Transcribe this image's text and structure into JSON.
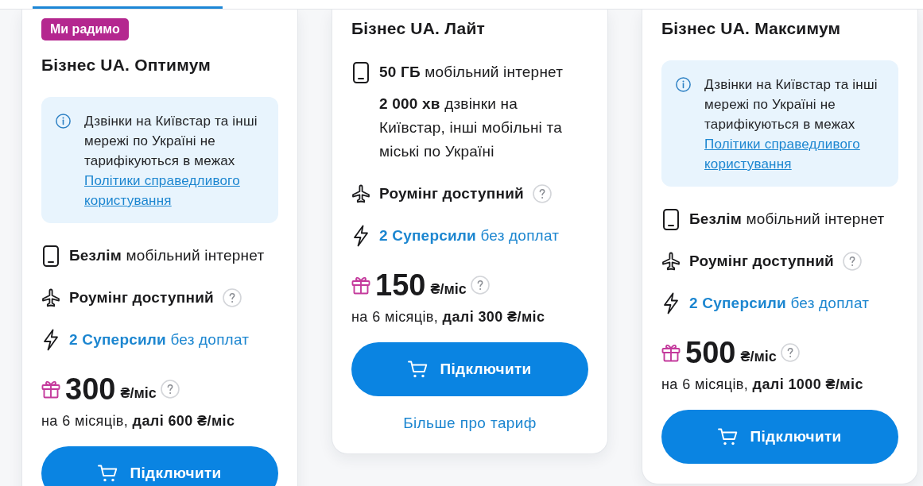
{
  "plans": [
    {
      "badge": "Ми радимо",
      "title": "Бізнес UA. Оптимум",
      "info": {
        "text": "Дзвінки на Київстар та інші мережі по Україні не тарифікуються в межах",
        "link": "Політики справедливого користування"
      },
      "features": [
        {
          "kind": "internet",
          "text": "**Безлім** мобільний інтернет",
          "help": false
        },
        {
          "kind": "roaming",
          "text": "Роумінг доступний",
          "help": true
        },
        {
          "kind": "superpowers",
          "text": "**2 Суперсили** без доплат",
          "help": false
        }
      ],
      "price": {
        "amount": "300",
        "unit": "₴/міс",
        "help": true,
        "note": "на 6 місяців, **далі 600 ₴/міс**"
      },
      "button": "Підключити"
    },
    {
      "title": "Бізнес UA. Лайт",
      "features": [
        {
          "kind": "internet",
          "text": "**50 ГБ** мобільний інтернет",
          "help": false
        },
        {
          "kind": "calls",
          "text": "**2 000 хв** дзвінки на Київстар, інші мобільні та міські по Україні",
          "help": false
        },
        {
          "kind": "roaming",
          "text": "Роумінг доступний",
          "help": true
        },
        {
          "kind": "superpowers",
          "text": "**2 Суперсили** без доплат",
          "help": false
        }
      ],
      "price": {
        "amount": "150",
        "unit": "₴/міс",
        "help": true,
        "note": "на 6 місяців, **далі 300 ₴/міс**"
      },
      "button": "Підключити",
      "more_link": "Більше про тариф"
    },
    {
      "title": "Бізнес UA. Максимум",
      "info": {
        "text": "Дзвінки на Київстар та інші мережі по Україні не тарифікуються в межах",
        "link": "Політики справедливого користування"
      },
      "features": [
        {
          "kind": "internet",
          "text": "**Безлім** мобільний інтернет",
          "help": false
        },
        {
          "kind": "roaming",
          "text": "Роумінг доступний",
          "help": true
        },
        {
          "kind": "superpowers",
          "text": "**2 Суперсили** без доплат",
          "help": false
        }
      ],
      "price": {
        "amount": "500",
        "unit": "₴/міс",
        "help": true,
        "note": "на 6 місяців, **далі 1000 ₴/міс**"
      },
      "button": "Підключити"
    }
  ]
}
